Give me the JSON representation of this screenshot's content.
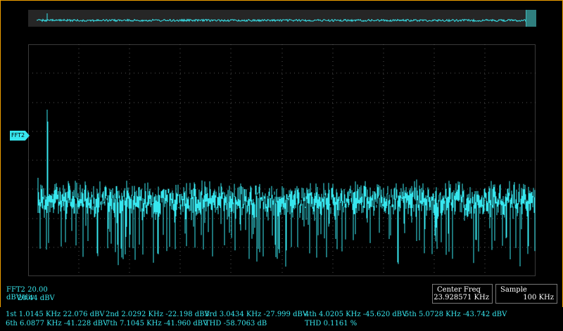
{
  "channel": {
    "marker_label": "FFT2",
    "scale_line1": "FFT2  20.00 dBV/div",
    "scale_line2": "20.44 dBV"
  },
  "center_freq": {
    "label": "Center Freq",
    "value": "23.928571 KHz"
  },
  "sample": {
    "label": "Sample",
    "value": "100 KHz"
  },
  "measurements": {
    "row1": [
      "1st 1.0145 KHz  22.076 dBV",
      "2nd 2.0292 KHz  -22.198 dBV",
      "3rd 3.0434 KHz  -27.999 dBV",
      "4th 4.0205 KHz  -45.620 dBV",
      "5th 5.0728 KHz  -43.742 dBV"
    ],
    "row2": [
      "6th 6.0877 KHz  -41.228 dBV",
      "7th 7.1045 KHz  -41.960 dBV",
      "THD  -58.7063 dB",
      "THD  0.1161 %"
    ]
  },
  "colors": {
    "trace": "#37e6ee",
    "frame": "#f0a000",
    "grid": "#555555"
  }
}
